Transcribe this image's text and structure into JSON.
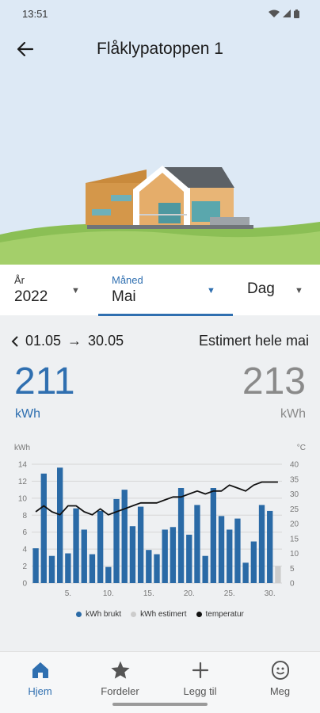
{
  "status_bar": {
    "time": "13:51"
  },
  "header": {
    "title": "Flåklypatoppen 1"
  },
  "period": {
    "year": {
      "label": "År",
      "value": "2022"
    },
    "month": {
      "label": "Måned",
      "value": "Mai"
    },
    "day": {
      "label": "Dag"
    }
  },
  "summary": {
    "range_start": "01.05",
    "range_arrow": "→",
    "range_end": "30.05",
    "estimate_label": "Estimert hele mai",
    "used_value": "211",
    "used_unit": "kWh",
    "estimated_value": "213",
    "estimated_unit": "kWh",
    "colors": {
      "used": "#2f6fb0",
      "estimated": "#8a8a8a"
    }
  },
  "chart_data": {
    "type": "bar",
    "ylabel": "kWh",
    "y2label": "°C",
    "ylim": [
      0,
      14
    ],
    "y2lim": [
      0,
      40
    ],
    "y_ticks": [
      "0",
      "2",
      "4",
      "6",
      "8",
      "10",
      "12",
      "14"
    ],
    "y2_ticks": [
      "0",
      "5",
      "10",
      "15",
      "20",
      "25",
      "30",
      "35",
      "40"
    ],
    "x_ticks": [
      "5.",
      "10.",
      "15.",
      "20.",
      "25.",
      "30."
    ],
    "x_tick_days": [
      5,
      10,
      15,
      20,
      25,
      30
    ],
    "days": [
      1,
      2,
      3,
      4,
      5,
      6,
      7,
      8,
      9,
      10,
      11,
      12,
      13,
      14,
      15,
      16,
      17,
      18,
      19,
      20,
      21,
      22,
      23,
      24,
      25,
      26,
      27,
      28,
      29,
      30,
      31
    ],
    "series": [
      {
        "name": "kWh brukt",
        "color": "#2a6aa6",
        "values": [
          4.1,
          12.9,
          3.2,
          13.6,
          3.5,
          8.8,
          6.3,
          3.4,
          8.5,
          1.9,
          9.9,
          11.0,
          6.7,
          9.0,
          3.9,
          3.4,
          6.3,
          6.6,
          11.2,
          5.7,
          9.2,
          3.2,
          11.2,
          7.9,
          6.3,
          7.6,
          2.4,
          4.9,
          9.2,
          8.5,
          null
        ]
      },
      {
        "name": "kWh estimert",
        "color": "#cccccc",
        "values": [
          null,
          null,
          null,
          null,
          null,
          null,
          null,
          null,
          null,
          null,
          null,
          null,
          null,
          null,
          null,
          null,
          null,
          null,
          null,
          null,
          null,
          null,
          null,
          null,
          null,
          null,
          null,
          null,
          null,
          null,
          2.0
        ]
      },
      {
        "name": "temperatur",
        "color": "#111111",
        "type": "line",
        "values": [
          24,
          26,
          24,
          23,
          26,
          26,
          24,
          23,
          25,
          23,
          24,
          25,
          26,
          27,
          27,
          27,
          28,
          29,
          29,
          30,
          31,
          30,
          31,
          31,
          33,
          32,
          31,
          33,
          34,
          34,
          34
        ]
      }
    ],
    "legend_position": "bottom",
    "grid": true
  },
  "nav": {
    "items": [
      {
        "label": "Hjem",
        "icon": "home-icon",
        "active": true
      },
      {
        "label": "Fordeler",
        "icon": "star-icon"
      },
      {
        "label": "Legg til",
        "icon": "plus-icon"
      },
      {
        "label": "Meg",
        "icon": "face-icon"
      }
    ]
  }
}
